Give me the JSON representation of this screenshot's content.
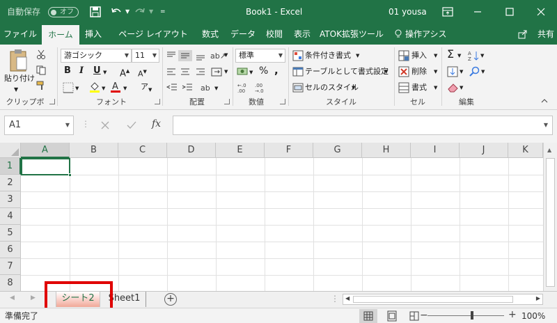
{
  "titlebar": {
    "autosave_label": "自動保存",
    "autosave_state": "オフ",
    "title": "Book1  -  Excel",
    "user": "01 yousa"
  },
  "tabs": [
    "ファイル",
    "ホーム",
    "挿入",
    "ページ レイアウト",
    "数式",
    "データ",
    "校閲",
    "表示",
    "ATOK拡張ツール",
    "操作アシスト",
    "共有"
  ],
  "active_tab": "ホーム",
  "ribbon": {
    "clipboard": {
      "paste_label": "貼り付け",
      "group_label": "クリップボード"
    },
    "font": {
      "font_name": "游ゴシック",
      "font_size": "11",
      "bold": "B",
      "italic": "I",
      "underline": "U",
      "group_label": "フォント"
    },
    "alignment": {
      "group_label": "配置"
    },
    "number": {
      "format": "標準",
      "percent": "%",
      "comma": ",",
      "group_label": "数値"
    },
    "styles": {
      "conditional": "条件付き書式",
      "table": "テーブルとして書式設定",
      "cell_styles": "セルのスタイル",
      "group_label": "スタイル"
    },
    "cells": {
      "insert": "挿入",
      "delete": "削除",
      "format": "書式",
      "group_label": "セル"
    },
    "editing": {
      "sigma": "Σ",
      "group_label": "編集"
    }
  },
  "formula_bar": {
    "name_box": "A1",
    "fx": "fx",
    "formula": ""
  },
  "grid": {
    "columns": [
      "A",
      "B",
      "C",
      "D",
      "E",
      "F",
      "G",
      "H",
      "I",
      "J",
      "K"
    ],
    "rows": [
      "1",
      "2",
      "3",
      "4",
      "5",
      "6",
      "7",
      "8"
    ],
    "active_cell": "A1"
  },
  "sheets": [
    "シート2",
    "Sheet1"
  ],
  "active_sheet": "シート2",
  "status": {
    "ready": "準備完了",
    "zoom": "100%"
  },
  "colors": {
    "accent": "#217346",
    "highlight": "#e00000"
  }
}
